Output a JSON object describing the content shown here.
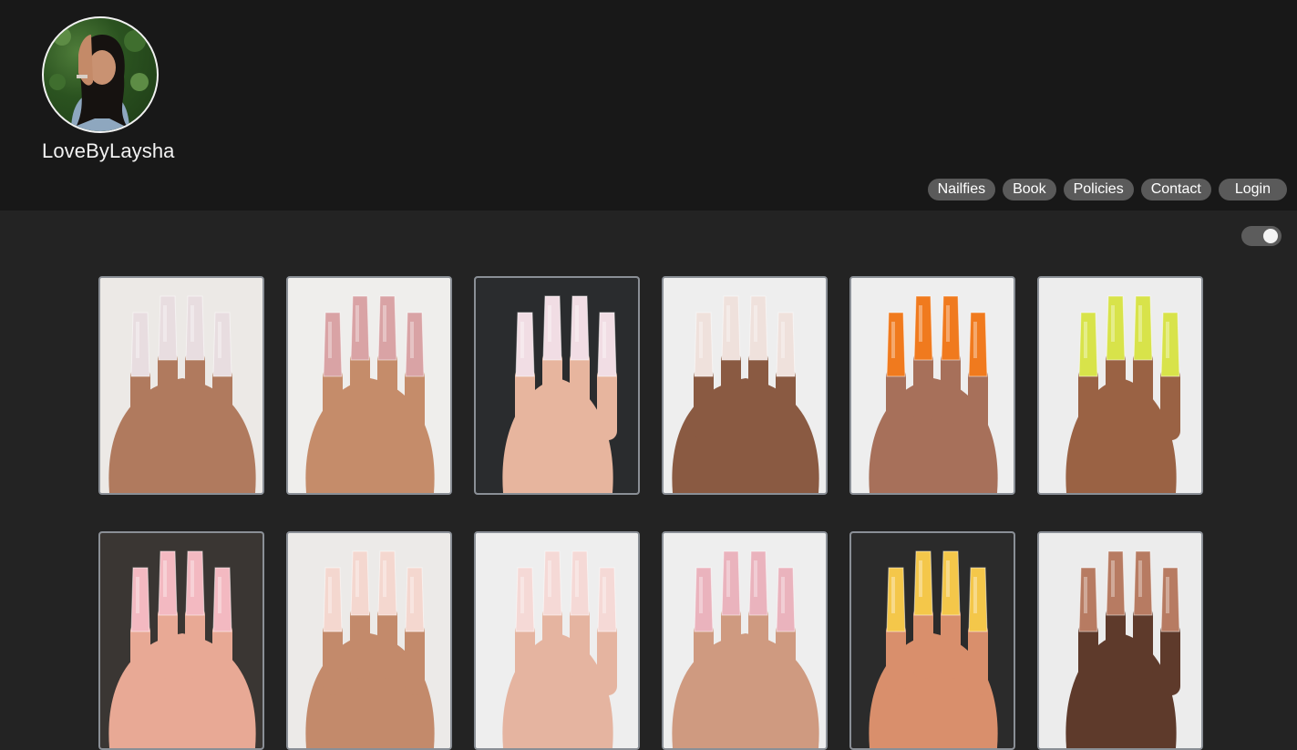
{
  "header": {
    "brand_name": "LoveByLaysha",
    "avatar_icon": "profile-photo"
  },
  "nav": {
    "items": [
      {
        "label": "Nailfies"
      },
      {
        "label": "Book"
      },
      {
        "label": "Policies"
      },
      {
        "label": "Contact"
      },
      {
        "label": "Login"
      }
    ]
  },
  "theme_toggle": {
    "state": "on",
    "icon": "toggle-switch"
  },
  "gallery": {
    "photos": [
      {
        "subject": "pink marble long nails",
        "bg": "#ece9e6",
        "skin": "#b07a5e",
        "nail": "#e8dde0"
      },
      {
        "subject": "nude pink french with gold",
        "bg": "#efeeec",
        "skin": "#c58c6a",
        "nail": "#d9a3a5"
      },
      {
        "subject": "white ombre coffin nails",
        "bg": "#2a2c2e",
        "skin": "#e7b59e",
        "nail": "#f1dde4"
      },
      {
        "subject": "gold glitter nude nails",
        "bg": "#eeeeee",
        "skin": "#8a5a42",
        "nail": "#efe1dc"
      },
      {
        "subject": "orange glitter nails",
        "bg": "#eeeeee",
        "skin": "#a7705a",
        "nail": "#f07a1e"
      },
      {
        "subject": "neon yellow green nails",
        "bg": "#ededed",
        "skin": "#9a6244",
        "nail": "#d8e34a"
      },
      {
        "subject": "pink rhinestone nails",
        "bg": "#3a3633",
        "skin": "#e8a995",
        "nail": "#f3b9c1"
      },
      {
        "subject": "black white swirl nails",
        "bg": "#eceae8",
        "skin": "#c38a6b",
        "nail": "#f4d7cf"
      },
      {
        "subject": "crystal glitter nails",
        "bg": "#eeeeee",
        "skin": "#e5b4a0",
        "nail": "#f5d9d6"
      },
      {
        "subject": "pink white snowflake nails",
        "bg": "#eeeeee",
        "skin": "#cf9a80",
        "nail": "#eab3bd"
      },
      {
        "subject": "yellow orange ombre nails",
        "bg": "#2b2b2b",
        "skin": "#d98f6c",
        "nail": "#f4c74a"
      },
      {
        "subject": "brown nude nails",
        "bg": "#ececec",
        "skin": "#5e3a2b",
        "nail": "#b77b62"
      }
    ]
  }
}
